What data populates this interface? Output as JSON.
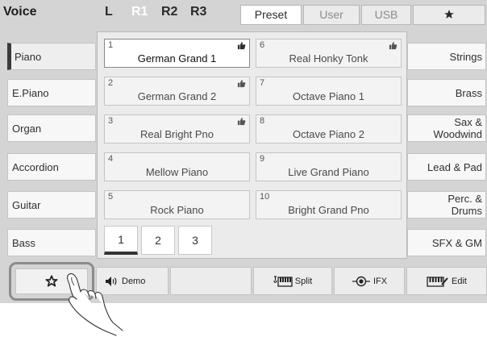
{
  "header": {
    "title": "Voice",
    "parts": [
      "L",
      "R1",
      "R2",
      "R3"
    ],
    "active_part": "R1",
    "tabs": [
      "Preset",
      "User",
      "USB"
    ],
    "selected_tab": "Preset",
    "favorites_tab_icon": "star-icon"
  },
  "left_categories": [
    "Piano",
    "E.Piano",
    "Organ",
    "Accordion",
    "Guitar",
    "Bass"
  ],
  "selected_left_category": "Piano",
  "right_categories": [
    "Strings",
    "Brass",
    "Sax & Woodwind",
    "Lead & Pad",
    "Perc. & Drums",
    "SFX & GM"
  ],
  "voices": [
    {
      "num": "1",
      "name": "German Grand 1"
    },
    {
      "num": "2",
      "name": "German Grand 2"
    },
    {
      "num": "3",
      "name": "Real Bright Pno"
    },
    {
      "num": "4",
      "name": "Mellow Piano"
    },
    {
      "num": "5",
      "name": "Rock Piano"
    },
    {
      "num": "6",
      "name": "Real Honky Tonk"
    },
    {
      "num": "7",
      "name": "Octave Piano 1"
    },
    {
      "num": "8",
      "name": "Octave Piano 2"
    },
    {
      "num": "9",
      "name": "Live Grand Piano"
    },
    {
      "num": "10",
      "name": "Bright Grand Pno"
    }
  ],
  "pages": [
    "1",
    "2",
    "3"
  ],
  "selected_page": "1",
  "bottom_bar": {
    "favorite_icon": "star-icon",
    "demo": "Demo",
    "split": "Split",
    "ifx": "IFX",
    "edit": "Edit"
  }
}
